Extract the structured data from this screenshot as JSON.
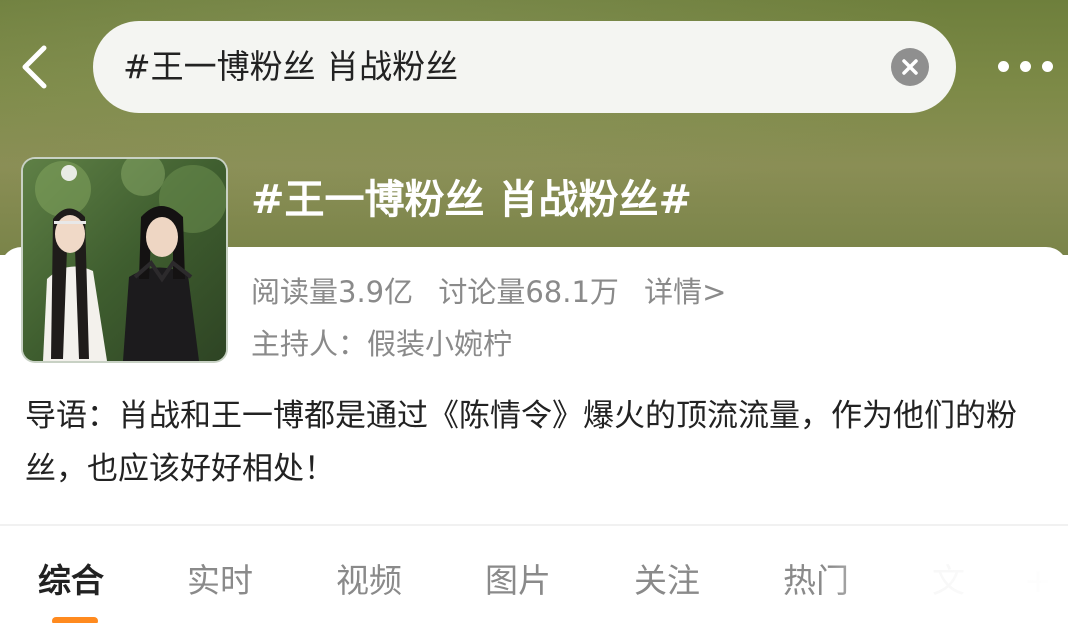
{
  "search": {
    "query": "#王一博粉丝 肖战粉丝"
  },
  "topic": {
    "title": "#王一博粉丝 肖战粉丝#",
    "reads": "阅读量3.9亿",
    "discussions": "讨论量68.1万",
    "details_link": "详情>",
    "host": "主持人：假装小婉柠",
    "intro": "导语：肖战和王一博都是通过《陈情令》爆火的顶流流量，作为他们的粉丝，也应该好好相处！"
  },
  "tabs": [
    {
      "label": "综合",
      "active": true
    },
    {
      "label": "实时",
      "active": false
    },
    {
      "label": "视频",
      "active": false
    },
    {
      "label": "图片",
      "active": false
    },
    {
      "label": "关注",
      "active": false
    },
    {
      "label": "热门",
      "active": false
    },
    {
      "label": "文",
      "active": false
    },
    {
      "label": "+",
      "active": false
    }
  ],
  "colors": {
    "banner": "#7d8a47",
    "active_tab_indicator": "#ff8a1f",
    "secondary_text": "#8a8a8a",
    "primary_text": "#222222"
  },
  "icons": {
    "back": "chevron-left-icon",
    "clear": "clear-circle-icon",
    "more": "more-dots-icon"
  }
}
